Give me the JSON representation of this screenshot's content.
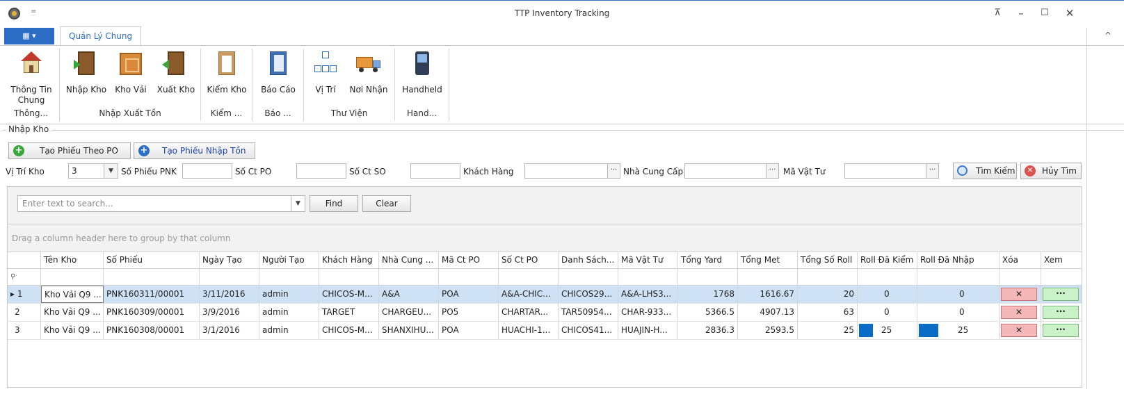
{
  "window": {
    "title": "TTP Inventory Tracking",
    "qat": "=",
    "buttons": {
      "restore_ribbon": "⊼",
      "minimize": "–",
      "maximize": "☐",
      "close": "✕"
    }
  },
  "ribbon": {
    "file_menu": "▦ ▾",
    "tab": "Quản Lý Chung",
    "collapse": "^",
    "groups": [
      {
        "label": "Thông...",
        "buttons": [
          {
            "label": "Thông Tin Chung",
            "icon": "house-icon"
          }
        ]
      },
      {
        "label": "Nhập Xuất Tồn",
        "buttons": [
          {
            "label": "Nhập Kho",
            "icon": "door-in-icon"
          },
          {
            "label": "Kho Vải",
            "icon": "box-icon"
          },
          {
            "label": "Xuất Kho",
            "icon": "door-out-icon"
          }
        ]
      },
      {
        "label": "Kiểm ...",
        "buttons": [
          {
            "label": "Kiểm Kho",
            "icon": "clipboard-icon"
          }
        ]
      },
      {
        "label": "Báo ...",
        "buttons": [
          {
            "label": "Báo Cáo",
            "icon": "notebook-icon"
          }
        ]
      },
      {
        "label": "Thư Viện",
        "buttons": [
          {
            "label": "Vị Trí",
            "icon": "network-icon"
          },
          {
            "label": "Nơi Nhận",
            "icon": "truck-icon"
          }
        ]
      },
      {
        "label": "Hand...",
        "buttons": [
          {
            "label": "Handheld",
            "icon": "handheld-icon"
          }
        ]
      }
    ]
  },
  "panel": {
    "title": "Nhập Kho",
    "create_po_button": "Tạo Phiếu Theo PO",
    "create_stock_button": "Tạo Phiếu Nhập Tồn"
  },
  "filters": {
    "vi_tri_kho_label": "Vị Trí Kho",
    "vi_tri_kho_value": "3",
    "so_phieu_pnk_label": "Số Phiếu PNK",
    "so_ct_po_label": "Số Ct PO",
    "so_ct_so_label": "Số Ct SO",
    "khach_hang_label": "Khách Hàng",
    "nha_cung_cap_label": "Nhà Cung Cấp",
    "ma_vat_tu_label": "Mã Vật Tư",
    "ellipsis": "···",
    "search_button": "Tìm Kiếm",
    "cancel_button": "Hủy Tìm"
  },
  "grid": {
    "search_placeholder": "Enter text to search...",
    "find_button": "Find",
    "clear_button": "Clear",
    "group_hint": "Drag a column header here to group by that column",
    "filter_icon": "⚲",
    "columns": [
      "Tên Kho",
      "Số Phiếu",
      "Ngày Tạo",
      "Người Tạo",
      "Khách Hàng",
      "Nhà Cung ...",
      "Mã Ct PO",
      "Số Ct PO",
      "Danh Sách...",
      "Mã Vật Tư",
      "Tổng Yard",
      "Tổng Met",
      "Tổng Số Roll",
      "Roll Đã Kiểm",
      "Roll Đã Nhập",
      "Xóa",
      "Xem"
    ],
    "rows": [
      {
        "indicator": "▸ 1",
        "ten_kho": "Kho Vải Q9 ...",
        "so_phieu": "PNK160311/00001",
        "ngay_tao": "3/11/2016",
        "nguoi_tao": "admin",
        "khach_hang": "CHICOS-M...",
        "nha_cung": "A&A",
        "ma_ct_po": "POA",
        "so_ct_po": "A&A-CHIC...",
        "danh_sach": "CHICOS29...",
        "ma_vat_tu": "A&A-LHS3...",
        "tong_yard": "1768",
        "tong_met": "1616.67",
        "tong_roll": "20",
        "roll_kiem": "0",
        "roll_nhap": "0",
        "kiem_progress": 0,
        "nhap_progress": 0,
        "xoa": "✕",
        "xem": "···"
      },
      {
        "indicator": "2",
        "ten_kho": "Kho Vải Q9 ...",
        "so_phieu": "PNK160309/00001",
        "ngay_tao": "3/9/2016",
        "nguoi_tao": "admin",
        "khach_hang": "TARGET",
        "nha_cung": "CHARGEU...",
        "ma_ct_po": "PO5",
        "so_ct_po": "CHARTAR...",
        "danh_sach": "TAR50954...",
        "ma_vat_tu": "CHAR-933...",
        "tong_yard": "5366.5",
        "tong_met": "4907.13",
        "tong_roll": "63",
        "roll_kiem": "0",
        "roll_nhap": "0",
        "kiem_progress": 0,
        "nhap_progress": 0,
        "xoa": "✕",
        "xem": "···"
      },
      {
        "indicator": "3",
        "ten_kho": "Kho Vải Q9 ...",
        "so_phieu": "PNK160308/00001",
        "ngay_tao": "3/1/2016",
        "nguoi_tao": "admin",
        "khach_hang": "CHICOS-M...",
        "nha_cung": "SHANXIHU...",
        "ma_ct_po": "POA",
        "so_ct_po": "HUACHI-1...",
        "danh_sach": "CHICOS41...",
        "ma_vat_tu": "HUAJIN-H...",
        "tong_yard": "2836.3",
        "tong_met": "2593.5",
        "tong_roll": "25",
        "roll_kiem": "25",
        "roll_nhap": "25",
        "kiem_progress": 1,
        "nhap_progress": 1,
        "xoa": "✕",
        "xem": "···"
      }
    ]
  }
}
